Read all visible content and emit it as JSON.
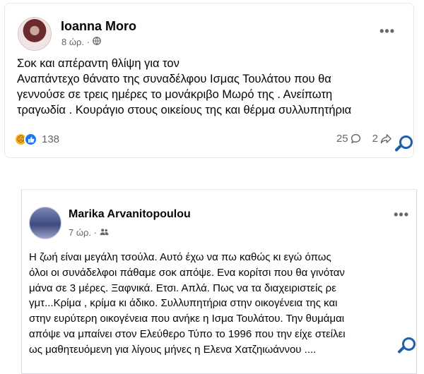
{
  "post1": {
    "author": "Ioanna Moro",
    "time": "8 ώρ. ·",
    "privacy_icon": "globe-icon",
    "more": "•••",
    "lines": [
      "Σοκ και απέραντη θλίψη για τον",
      "Αναπάντεχο θάνατο της συναδέλφου Ισμας Τουλάτου που θα",
      "γεννούσε σε τρεις ημέρες το μονάκριβο Μωρό της . Ανείπωτη",
      "τραγωδία . Κουράγιο στους οικείους της και θέρμα συλλυπητήρια"
    ],
    "reaction_icons": [
      "sad-reaction-icon",
      "like-reaction-icon"
    ],
    "reaction_count": "138",
    "comment_count": "25",
    "share_count": "2"
  },
  "post2": {
    "author": "Marika Arvanitopoulou",
    "time": "7 ώρ. ·",
    "privacy_icon": "friends-icon",
    "more": "•••",
    "lines": [
      "Η ζωή είναι μεγάλη τσούλα.  Αυτό έχω να πω καθώς κι εγώ όπως",
      "όλοι οι συνάδελφοι πάθαμε σοκ απόψε. Ενα κορίτσι που θα γινόταν",
      "μάνα σε 3 μέρες. Ξαφνικά. Ετσι. Απλά. Πως να τα διαχειριστείς ρε",
      "γμτ...Κρίμα , κρίμα κι άδικο. Συλλυπητήρια στην οικογένεια της και",
      "στην ευρύτερη οικογένεια που ανήκε η Ισμα Τουλάτου. Την θυμάμαι",
      "απόψε να μπαίνει στον Ελεύθερο Τύπο το 1996 που την είχε στείλει",
      "ως μαθητευόμενη για λίγους μήνες η Ελενα Χατζηιωάννου ...."
    ]
  },
  "colors": {
    "text": "#050505",
    "secondary": "#65676b",
    "like_blue": "#1877f2",
    "sad_yellow": "#f7b125",
    "zoom_blue": "#1d5fa8"
  }
}
